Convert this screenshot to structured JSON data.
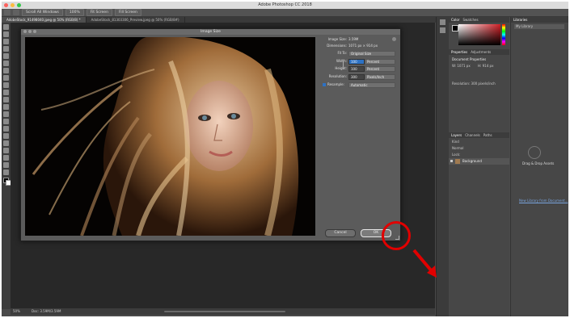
{
  "app": {
    "title": "Adobe Photoshop CC 2018"
  },
  "options_bar": {
    "buttons": [
      "Scroll All Windows",
      "100%",
      "Fit Screen",
      "Fill Screen"
    ]
  },
  "doc_tabs": [
    {
      "label": "AdobeStock_91498040.jpeg @ 50% (RGB/8) *",
      "active": true
    },
    {
      "label": "AdobeStock_81303306_Preview.jpeg @ 50% (RGB/8#)",
      "active": false
    }
  ],
  "image_size_dialog": {
    "title": "Image Size",
    "image_size_label": "Image Size:",
    "image_size_value": "3.59M",
    "dimensions_label": "Dimensions:",
    "dimensions_value": "1071 px × 914 px",
    "fit_to_label": "Fit To:",
    "fit_to_value": "Original Size",
    "width_label": "Width:",
    "width_value": "100",
    "width_unit": "Percent",
    "height_label": "Height:",
    "height_value": "100",
    "height_unit": "Percent",
    "resolution_label": "Resolution:",
    "resolution_value": "300",
    "resolution_unit": "Pixels/Inch",
    "resample_label": "Resample:",
    "resample_value": "Automatic",
    "cancel_label": "Cancel",
    "ok_label": "OK"
  },
  "status_bar": {
    "zoom": "50%",
    "doc": "Doc: 3.59M/3.59M"
  },
  "panels": {
    "color_tabs": [
      "Color",
      "Swatches"
    ],
    "properties_tabs": [
      "Properties",
      "Adjustments"
    ],
    "doc_props_title": "Document Properties",
    "w_label": "W: 1071 px",
    "h_label": "H: 914 px",
    "resolution_text": "Resolution: 300 pixels/inch",
    "layers_tabs": [
      "Layers",
      "Channels",
      "Paths"
    ],
    "layer_filter": "Kind",
    "blend_mode": "Normal",
    "lock_label": "Lock:",
    "background_layer": "Background",
    "libraries_tab": "Libraries",
    "library_select": "My Library",
    "drag_drop_title": "Drag & Drop Assets",
    "new_library_link": "New Library from Document..."
  },
  "colors": {
    "highlight_red": "#e10000",
    "selection_blue": "#2d72c4"
  }
}
